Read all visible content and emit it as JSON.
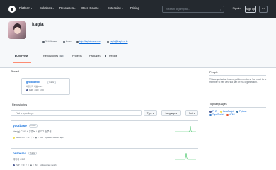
{
  "topbar": {
    "nav": [
      {
        "label": "Platform"
      },
      {
        "label": "Solutions"
      },
      {
        "label": "Resources"
      },
      {
        "label": "Open Source"
      },
      {
        "label": "Enterprise"
      },
      {
        "label": "Pricing"
      }
    ],
    "search_placeholder": "Search or jump to...",
    "search_key": "/",
    "sign_in": "Sign in",
    "sign_up": "Sign up",
    "more": "..."
  },
  "org": {
    "name": "kagla",
    "meta": [
      {
        "label": "36 followers"
      },
      {
        "label": "Korea"
      },
      {
        "label": "http://kaglakorea.com"
      },
      {
        "label": "kagla@kagla.or.kr"
      }
    ]
  },
  "tabs": [
    {
      "label": "Overview",
      "count": ""
    },
    {
      "label": "Repositories",
      "count": "10"
    },
    {
      "label": "Projects",
      "count": ""
    },
    {
      "label": "Packages",
      "count": ""
    },
    {
      "label": "People",
      "count": ""
    }
  ],
  "pinned": {
    "title": "Pinned",
    "card": {
      "name": "gnuboard5",
      "badge": "Public",
      "desc": "대한민국 대표 CMS",
      "lang": "PHP",
      "stars": "320",
      "forks": "203"
    }
  },
  "repositories": {
    "title": "Repositories",
    "filter_placeholder": "Find a repository...",
    "type_label": "Type",
    "language_label": "Language",
    "sort_label": "Sort",
    "items": [
      {
        "name": "youtbase",
        "badge": "Public",
        "desc": "Neo(g) CMS + 유튜브 / 블로그 솔루션",
        "lang": "JavaScript",
        "lang_color": "#f1e05a",
        "stars": "1",
        "forks": "0",
        "issues": "0",
        "prs": "0",
        "updated": "Updated 3 weeks ago"
      },
      {
        "name": "burncms",
        "badge": "Public",
        "desc": "메이저 CMS",
        "lang": "PHP",
        "lang_color": "#4F5D95",
        "stars": "0",
        "forks": "0",
        "issues": "0",
        "prs": "0",
        "updated": "Updated last month"
      }
    ]
  },
  "sidebar": {
    "people_title": "People",
    "people_text": "This organization has no public members. You must be a member to see who's a part of this organization.",
    "lang_title": "Top languages",
    "languages": [
      {
        "name": "PHP",
        "color": "#4F5D95"
      },
      {
        "name": "JavaScript",
        "color": "#f1e05a"
      },
      {
        "name": "Python",
        "color": "#3572A5"
      },
      {
        "name": "TypeScript",
        "color": "#3178c6"
      },
      {
        "name": "HTML",
        "color": "#e34c26"
      }
    ]
  }
}
